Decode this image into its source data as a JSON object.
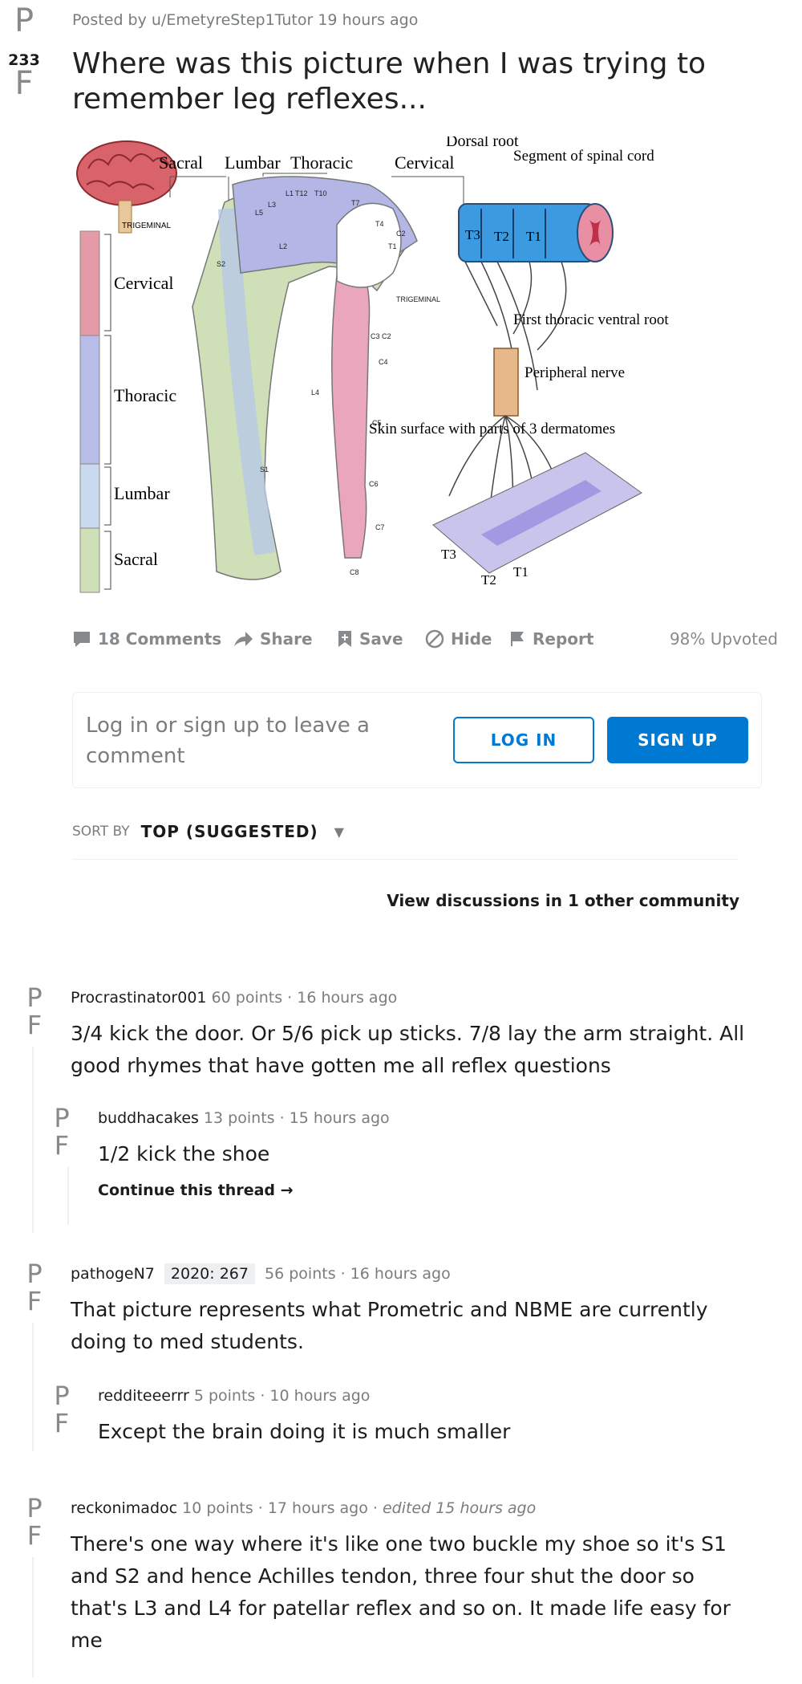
{
  "post": {
    "vote_up_glyph": "P",
    "vote_down_glyph": "F",
    "score": "233",
    "meta": "Posted by u/EmetyreStep1Tutor 19 hours ago",
    "title": "Where was this picture when I was trying to remember leg reflexes..."
  },
  "figure": {
    "brain_labels": {
      "trigeminal": "TRIGEMINAL",
      "cervical": "Cervical",
      "thoracic": "Thoracic",
      "lumbar": "Lumbar",
      "sacral": "Sacral"
    },
    "body_labels": {
      "sacral": "Sacral",
      "lumbar": "Lumbar",
      "thoracic": "Thoracic",
      "cervical": "Cervical",
      "trigeminal": "TRIGEMINAL",
      "l5": "L5",
      "l3": "L3",
      "l1": "L1",
      "t12": "T12",
      "t10": "T10",
      "t7": "T7",
      "t4": "T4",
      "c2": "C2",
      "t1": "T1",
      "s2": "S2",
      "l2": "L2",
      "c3c2": "C3 C2",
      "c4": "C4",
      "l4": "L4",
      "c5": "C5",
      "s1": "S1",
      "c6": "C6",
      "c7": "C7",
      "c8": "C8"
    },
    "cord_labels": {
      "dorsal_root": "Dorsal root",
      "segment": "Segment of spinal cord",
      "t3": "T3",
      "t2": "T2",
      "t1": "T1",
      "first_thoracic": "First thoracic ventral root",
      "peripheral": "Peripheral nerve",
      "skin": "Skin surface with parts of 3 dermatomes",
      "skin_t3": "T3",
      "skin_t2": "T2",
      "skin_t1": "T1"
    }
  },
  "actions": {
    "comments": "18 Comments",
    "share": "Share",
    "save": "Save",
    "hide": "Hide",
    "report": "Report",
    "upvoted": "98% Upvoted"
  },
  "login": {
    "prompt": "Log in or sign up to leave a comment",
    "login_label": "LOG IN",
    "signup_label": "SIGN UP"
  },
  "sort": {
    "label": "SORT BY",
    "value": "TOP (SUGGESTED)"
  },
  "view_discussions": "View discussions in 1 other community",
  "comments": [
    {
      "author": "Procrastinator001",
      "flair": "",
      "points": "60 points · 16 hours ago",
      "edited": "",
      "body": "3/4 kick the door. Or 5/6 pick up sticks. 7/8 lay the arm straight. All good rhymes that have gotten me all reflex questions"
    },
    {
      "author": "buddhacakes",
      "flair": "",
      "points": "13 points · 15 hours ago",
      "edited": "",
      "body": "1/2 kick the shoe",
      "continue": "Continue this thread →"
    },
    {
      "author": "pathogeN7",
      "flair": "2020: 267",
      "points": "56 points · 16 hours ago",
      "edited": "",
      "body": "That picture represents what Prometric and NBME are currently doing to med students."
    },
    {
      "author": "redditeeerrr",
      "flair": "",
      "points": "5 points · 10 hours ago",
      "edited": "",
      "body": "Except the brain doing it is much smaller"
    },
    {
      "author": "reckonimadoc",
      "flair": "",
      "points": "10 points · 17 hours ago · ",
      "edited": "edited 15 hours ago",
      "body": "There's one way where it's like one two buckle my shoe so it's S1 and S2 and hence Achilles tendon, three four shut the door so that's L3 and L4 for patellar reflex and so on. It made life easy for me"
    }
  ]
}
